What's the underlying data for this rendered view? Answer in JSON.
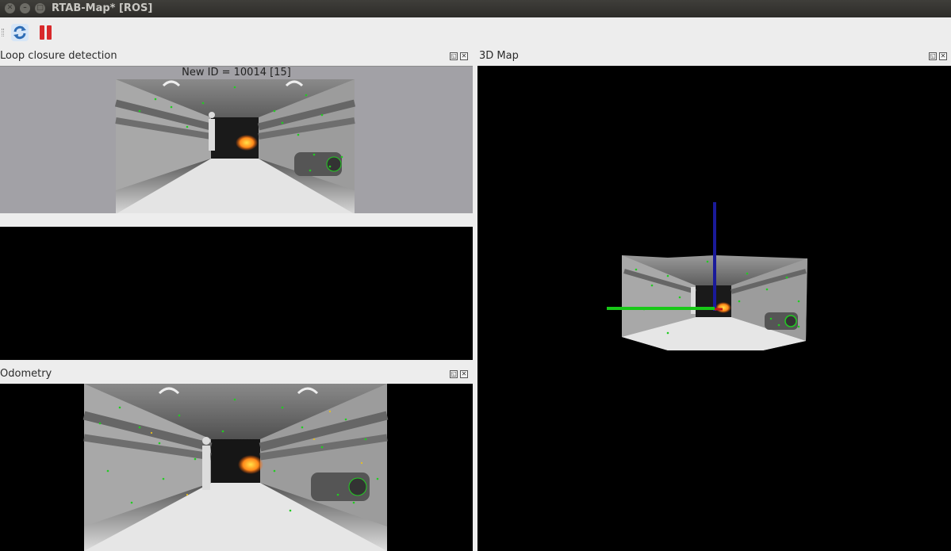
{
  "window": {
    "title": "RTAB-Map* [ROS]",
    "controls": [
      "close",
      "minimize",
      "maximize"
    ]
  },
  "toolbar": {
    "buttons": [
      {
        "name": "refresh",
        "icon": "refresh-icon"
      },
      {
        "name": "pause",
        "icon": "pause-icon"
      }
    ]
  },
  "panels": {
    "loop_closure": {
      "title": "Loop closure detection",
      "new_id_label": "New ID = 10014 [15]"
    },
    "odometry": {
      "title": "Odometry"
    },
    "map3d": {
      "title": "3D Map"
    }
  },
  "colors": {
    "feature_points": "#22cc22",
    "axis_x_green": "#18c818",
    "axis_z_blue": "#1a1a9a",
    "loop_bg": "#a2a1a6",
    "title_bar": "#3a3935",
    "pause_red": "#d8292b",
    "refresh_blue": "#2f6db5"
  }
}
